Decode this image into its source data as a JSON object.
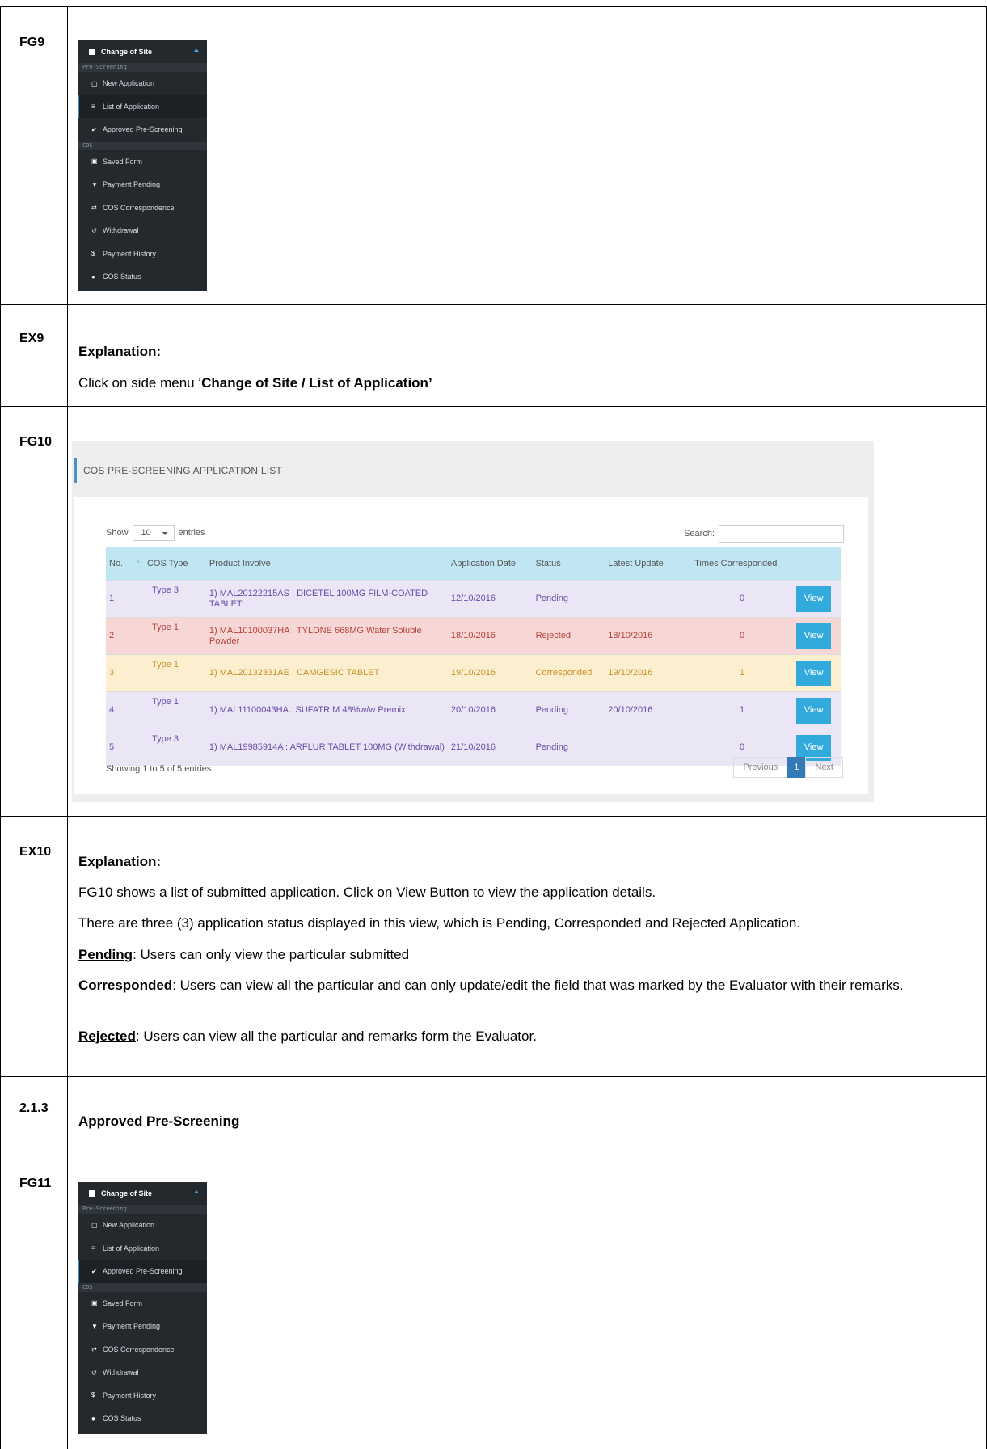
{
  "rows": {
    "fg9": "FG9",
    "ex9": "EX9",
    "fg10": "FG10",
    "ex10": "EX10",
    "sec213": "2.1.3",
    "fg11": "FG11"
  },
  "sidebar_fg9": {
    "title": "Change of Site",
    "section1": "Pre-Screening",
    "items_prescreen": [
      {
        "icon": "document-icon",
        "glyph": "▢",
        "label": "New Application"
      },
      {
        "icon": "list-icon",
        "glyph": "≡",
        "label": "List of Application"
      },
      {
        "icon": "check-icon",
        "glyph": "✔",
        "label": "Approved Pre-Screening"
      }
    ],
    "section2": "COS",
    "items_cos": [
      {
        "icon": "save-icon",
        "glyph": "▣",
        "label": "Saved Form"
      },
      {
        "icon": "cart-icon",
        "glyph": "▼",
        "label": "Payment Pending"
      },
      {
        "icon": "exchange-icon",
        "glyph": "⇄",
        "label": "COS Correspondence"
      },
      {
        "icon": "undo-icon",
        "glyph": "↺",
        "label": "Withdrawal"
      },
      {
        "icon": "dollar-icon",
        "glyph": "$",
        "label": "Payment History"
      },
      {
        "icon": "info-icon",
        "glyph": "●",
        "label": "COS Status"
      }
    ]
  },
  "ex9": {
    "heading": "Explanation:",
    "text_prefix": "Click on side menu ‘",
    "text_bold": "Change of Site / List of Application’"
  },
  "list": {
    "panel_title": "COS PRE-SCREENING APPLICATION LIST",
    "show_label": "Show",
    "entries_value": "10",
    "entries_label": "entries",
    "search_label": "Search:",
    "columns": [
      "No.",
      "COS Type",
      "Product Involve",
      "Application Date",
      "Status",
      "Latest Update",
      "Times Corresponded",
      ""
    ],
    "rows": [
      {
        "no": "1",
        "type": "Type 3",
        "product": "1) MAL20122215AS : DICETEL 100MG FILM-COATED TABLET",
        "date": "12/10/2016",
        "status": "Pending",
        "update": "",
        "times": "0",
        "action": "View",
        "state": "pending"
      },
      {
        "no": "2",
        "type": "Type 1",
        "product": "1) MAL10100037HA : TYLONE 668MG Water Soluble Powder",
        "date": "18/10/2016",
        "status": "Rejected",
        "update": "18/10/2016",
        "times": "0",
        "action": "View",
        "state": "rejected"
      },
      {
        "no": "3",
        "type": "Type 1",
        "product": "1) MAL20132331AE : CAMGESIC TABLET",
        "date": "19/10/2016",
        "status": "Corresponded",
        "update": "19/10/2016",
        "times": "1",
        "action": "View",
        "state": "corr"
      },
      {
        "no": "4",
        "type": "Type 1",
        "product": "1) MAL11100043HA : SUFATRIM 48%w/w Premix",
        "date": "20/10/2016",
        "status": "Pending",
        "update": "20/10/2016",
        "times": "1",
        "action": "View",
        "state": "pending"
      },
      {
        "no": "5",
        "type": "Type 3",
        "product": "1) MAL19985914A : ARFLUR TABLET 100MG (Withdrawal)",
        "date": "21/10/2016",
        "status": "Pending",
        "update": "",
        "times": "0",
        "action": "View",
        "state": "pending"
      }
    ],
    "info": "Showing 1 to 5 of 5 entries",
    "prev": "Previous",
    "page": "1",
    "next": "Next"
  },
  "ex10": {
    "heading": "Explanation:",
    "p1": "FG10 shows a list of submitted application. Click on View Button to view the application details.",
    "p2": "There are three (3) application status displayed in this view, which is Pending, Corresponded and Rejected Application.",
    "pending_term": "Pending",
    "pending_text": ": Users can only view the particular submitted",
    "corr_term": "Corresponded",
    "corr_text": ": Users can view all the particular and can only update/edit the field that was marked by the Evaluator with their remarks.",
    "rej_term": "Rejected",
    "rej_text": ": Users can view all the particular and remarks form the Evaluator."
  },
  "sec213": {
    "title": "Approved Pre-Screening"
  },
  "sidebar_fg11": {
    "title": "Change of Site",
    "section1": "Pre-Screening",
    "items_prescreen": [
      {
        "icon": "document-icon",
        "glyph": "▢",
        "label": "New Application"
      },
      {
        "icon": "list-icon",
        "glyph": "≡",
        "label": "List of Application"
      },
      {
        "icon": "check-icon",
        "glyph": "✔",
        "label": "Approved Pre-Screening"
      }
    ],
    "section2": "COS",
    "items_cos": [
      {
        "icon": "save-icon",
        "glyph": "▣",
        "label": "Saved Form"
      },
      {
        "icon": "cart-icon",
        "glyph": "▼",
        "label": "Payment Pending"
      },
      {
        "icon": "exchange-icon",
        "glyph": "⇄",
        "label": "COS Correspondence"
      },
      {
        "icon": "undo-icon",
        "glyph": "↺",
        "label": "Withdrawal"
      },
      {
        "icon": "dollar-icon",
        "glyph": "$",
        "label": "Payment History"
      },
      {
        "icon": "info-icon",
        "glyph": "●",
        "label": "COS Status"
      }
    ]
  }
}
